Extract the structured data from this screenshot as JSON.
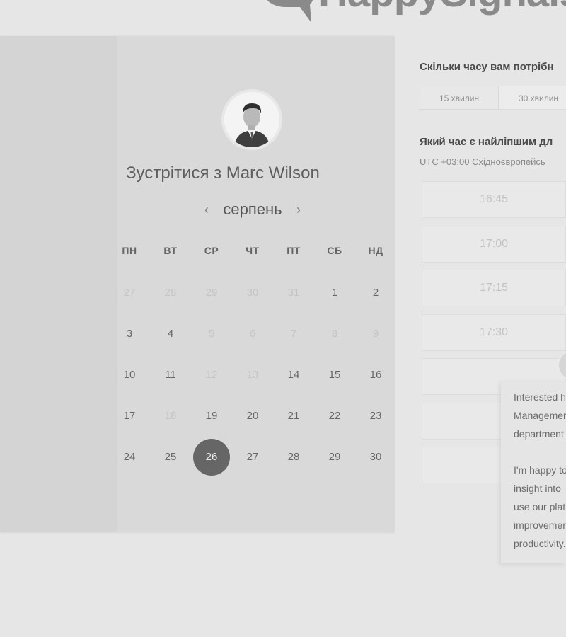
{
  "header": {
    "brand": "HappySignals"
  },
  "calendar": {
    "title": "Зустрітися з Marc Wilson",
    "month": "серпень",
    "prev_icon": "chevron-left-icon",
    "next_icon": "chevron-right-icon",
    "weekdays": [
      "ПН",
      "ВТ",
      "СР",
      "ЧТ",
      "ПТ",
      "СБ",
      "НД"
    ],
    "weeks": [
      [
        {
          "d": "27",
          "muted": true
        },
        {
          "d": "28",
          "muted": true
        },
        {
          "d": "29",
          "muted": true
        },
        {
          "d": "30",
          "muted": true
        },
        {
          "d": "31",
          "muted": true
        },
        {
          "d": "1",
          "muted": false
        },
        {
          "d": "2",
          "muted": false
        }
      ],
      [
        {
          "d": "3",
          "muted": false
        },
        {
          "d": "4",
          "muted": false
        },
        {
          "d": "5",
          "muted": true
        },
        {
          "d": "6",
          "muted": true
        },
        {
          "d": "7",
          "muted": true
        },
        {
          "d": "8",
          "muted": true
        },
        {
          "d": "9",
          "muted": true
        }
      ],
      [
        {
          "d": "10",
          "muted": false
        },
        {
          "d": "11",
          "muted": false
        },
        {
          "d": "12",
          "muted": true
        },
        {
          "d": "13",
          "muted": true
        },
        {
          "d": "14",
          "muted": false
        },
        {
          "d": "15",
          "muted": false
        },
        {
          "d": "16",
          "muted": false
        }
      ],
      [
        {
          "d": "17",
          "muted": false
        },
        {
          "d": "18",
          "muted": true
        },
        {
          "d": "19",
          "muted": false
        },
        {
          "d": "20",
          "muted": false
        },
        {
          "d": "21",
          "muted": false
        },
        {
          "d": "22",
          "muted": false
        },
        {
          "d": "23",
          "muted": false
        }
      ],
      [
        {
          "d": "24",
          "muted": false
        },
        {
          "d": "25",
          "muted": false
        },
        {
          "d": "26",
          "muted": false,
          "selected": true
        },
        {
          "d": "27",
          "muted": false
        },
        {
          "d": "28",
          "muted": false
        },
        {
          "d": "29",
          "muted": false
        },
        {
          "d": "30",
          "muted": false
        }
      ]
    ]
  },
  "booking": {
    "duration_question": "Скільки часу вам потрібн",
    "durations": [
      "15 хвилин",
      "30 хвилин"
    ],
    "time_question": "Який час є найліпшим дл",
    "timezone": "UTC +03:00 Східноєвропейсь",
    "slots": [
      "16:45",
      "17:00",
      "17:15",
      "17:30",
      "",
      "",
      ""
    ]
  },
  "chat": {
    "lines1": [
      "Interested h",
      "Managemer",
      "department"
    ],
    "lines2": [
      "I'm happy to",
      "insight into",
      "use our plat",
      "improvemer",
      "productivity."
    ]
  }
}
